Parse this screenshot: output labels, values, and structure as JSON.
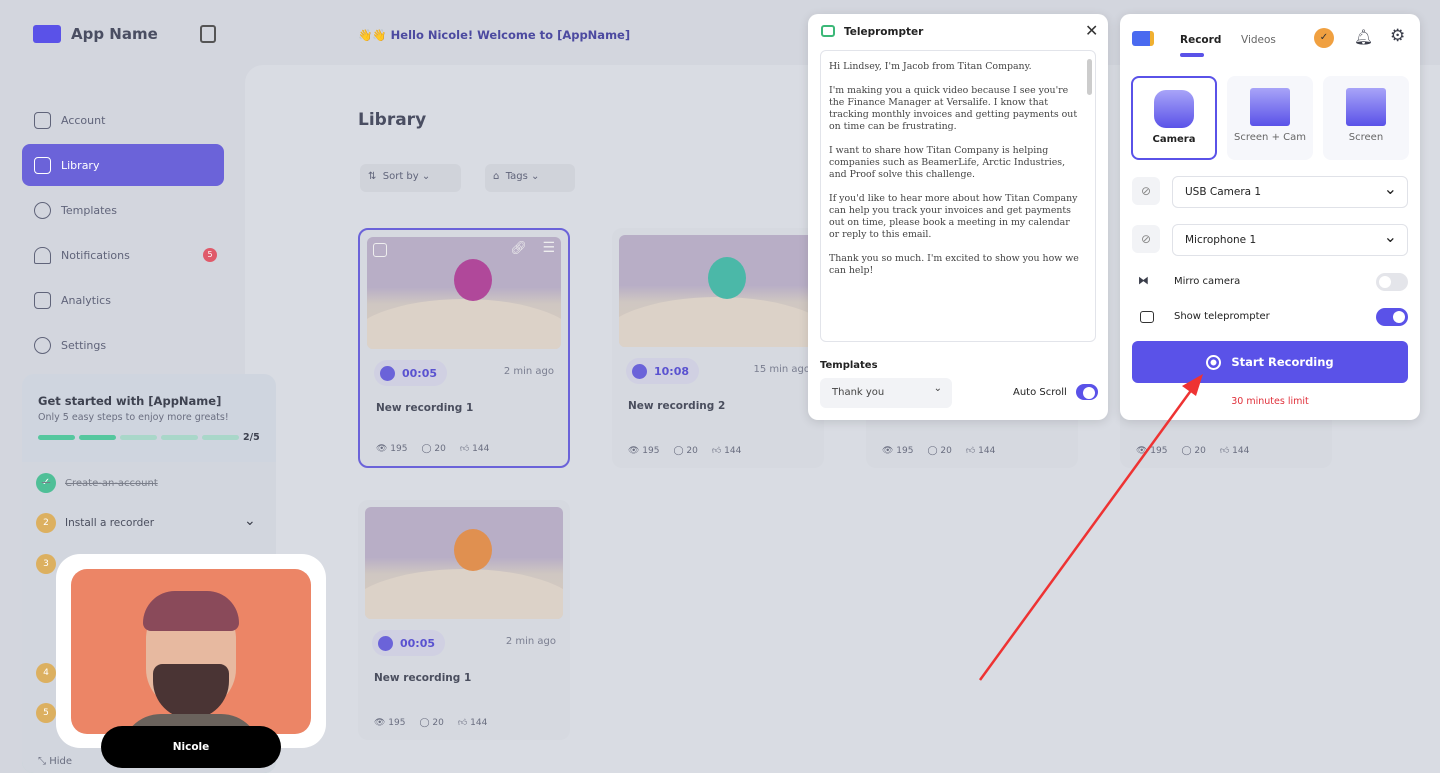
{
  "app": {
    "name": "App Name",
    "greeting": "Hello Nicole! Welcome to [AppName]",
    "greeting_emoji": "👋👋"
  },
  "sidebar": {
    "items": [
      {
        "label": "Account",
        "icon": "user-icon"
      },
      {
        "label": "Library",
        "icon": "library-icon",
        "active": true
      },
      {
        "label": "Templates",
        "icon": "templates-icon"
      },
      {
        "label": "Notifications",
        "icon": "bell-icon",
        "badge": "5"
      },
      {
        "label": "Analytics",
        "icon": "chart-icon"
      },
      {
        "label": "Settings",
        "icon": "gear-icon"
      }
    ]
  },
  "onboarding": {
    "title": "Get started with [AppName]",
    "subtitle": "Only 5 easy steps to enjoy more greats!",
    "progress": "2/5",
    "progress_value": 0.4,
    "steps": [
      {
        "num": "✓",
        "label": "Create-an-account",
        "done": true
      },
      {
        "num": "2",
        "label": "Install a recorder"
      },
      {
        "num": "3"
      },
      {
        "num": "4"
      },
      {
        "num": "5"
      }
    ],
    "hide_label": "Hide"
  },
  "library": {
    "title": "Library",
    "sort_label": "Sort by",
    "tags_label": "Tags",
    "cards": [
      {
        "duration": "00:05",
        "ago": "2 min ago",
        "title": "New recording 1",
        "views": "195",
        "comments": "20",
        "likes": "144",
        "char_color": "#b0489a"
      },
      {
        "duration": "10:08",
        "ago": "15 min ago",
        "title": "New recording 2",
        "views": "195",
        "comments": "20",
        "likes": "144",
        "char_color": "#4bb8a8"
      },
      {
        "duration": "",
        "ago": "",
        "title": "",
        "views": "195",
        "comments": "20",
        "likes": "144",
        "char_color": "#999"
      },
      {
        "duration": "",
        "ago": "",
        "title": "",
        "views": "195",
        "comments": "20",
        "likes": "144",
        "char_color": "#999"
      },
      {
        "duration": "00:05",
        "ago": "2 min ago",
        "title": "New recording 1",
        "views": "195",
        "comments": "20",
        "likes": "144",
        "char_color": "#e09050"
      }
    ]
  },
  "camera_bubble": {
    "name": "Nicole",
    "bg": "#ec8566"
  },
  "teleprompter": {
    "title": "Teleprompter",
    "paragraphs": [
      "Hi Lindsey, I'm Jacob from Titan Company.",
      "I'm making you a quick video because I see you're the Finance Manager at Versalife. I know that tracking monthly invoices and getting payments out on time can be frustrating.",
      "I want to share how Titan Company is helping companies such as BeamerLife, Arctic Industries, and Proof solve this challenge.",
      "If you'd like to hear more about how Titan Company can help you track your invoices and get payments out on time, please book a meeting in my calendar or reply to this email.",
      "Thank you so much. I'm excited to show you how we can help!"
    ],
    "templates_label": "Templates",
    "template_value": "Thank you",
    "auto_scroll_label": "Auto Scroll",
    "auto_scroll": true
  },
  "recorder": {
    "tabs": [
      "Record",
      "Videos"
    ],
    "active_tab": "Record",
    "modes": [
      "Camera",
      "Screen + Cam",
      "Screen"
    ],
    "active_mode": "Camera",
    "camera": "USB Camera 1",
    "microphone": "Microphone 1",
    "mirror_label": "Mirro camera",
    "mirror": false,
    "show_tp_label": "Show teleprompter",
    "show_tp": true,
    "start_label": "Start Recording",
    "limit": "30 minutes limit",
    "accent": "#5a52e8",
    "limit_color": "#e0303a"
  }
}
